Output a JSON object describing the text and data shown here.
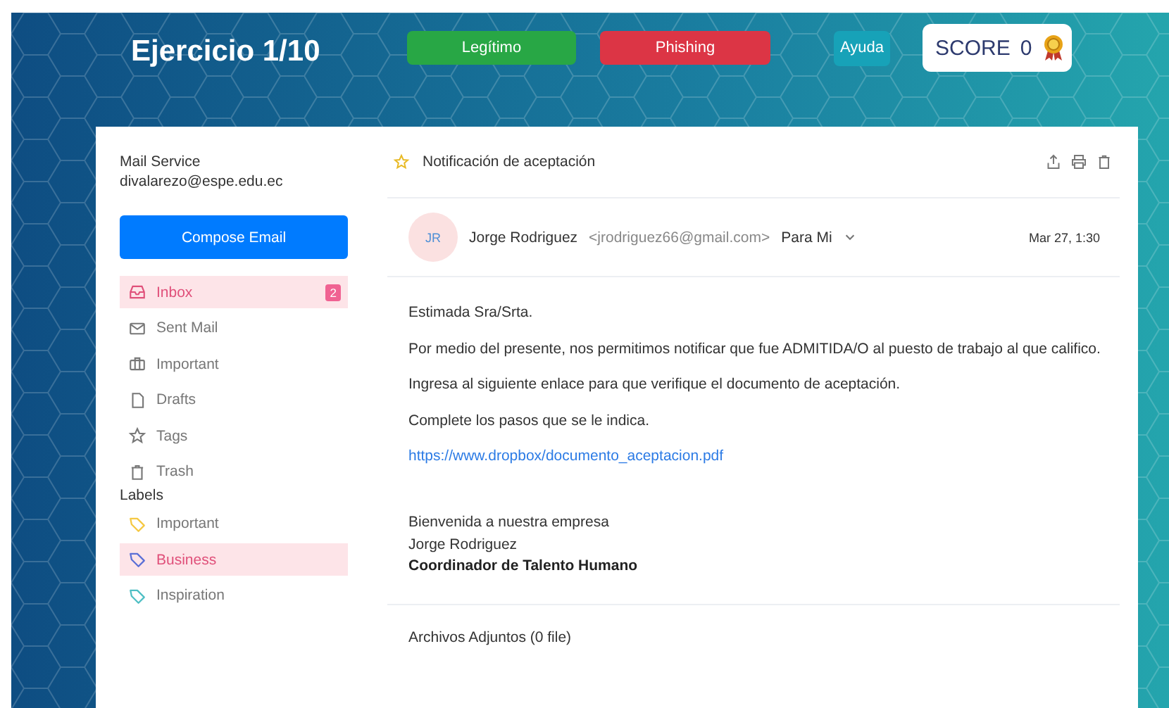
{
  "header": {
    "title": "Ejercicio 1/10",
    "buttons": [
      {
        "label": "Legítimo",
        "kind": "legit"
      },
      {
        "label": "Phishing",
        "kind": "phishing"
      },
      {
        "label": "Ayuda",
        "kind": "help"
      }
    ],
    "score": {
      "label": "SCORE",
      "value": "0"
    }
  },
  "sidebar": {
    "service": "Mail Service",
    "account": "divalarezo@espe.edu.ec",
    "compose": "Compose Email",
    "folders": [
      {
        "label": "Inbox",
        "selected": true,
        "badge": "2"
      },
      {
        "label": "Sent Mail",
        "selected": false
      },
      {
        "label": "Important",
        "selected": false
      },
      {
        "label": "Drafts",
        "selected": false
      },
      {
        "label": "Tags",
        "selected": false
      },
      {
        "label": "Trash",
        "selected": false
      }
    ],
    "labels_heading": "Labels",
    "labels": [
      {
        "label": "Important",
        "color": "#f5c842",
        "selected": false
      },
      {
        "label": "Business",
        "color": "#5b6fd6",
        "selected": true
      },
      {
        "label": "Inspiration",
        "color": "#4fbfc4",
        "selected": false
      }
    ]
  },
  "email": {
    "subject": "Notificación de aceptación",
    "starred": false,
    "initials": "JR",
    "sender": "Jorge Rodriguez",
    "address": "<jrodriguez66@gmail.com>",
    "recipient": "Para Mi",
    "date": "Mar 27, 1:30",
    "paragraphs": [
      {
        "kind": "text",
        "text": "Estimada Sra/Srta."
      },
      {
        "kind": "text",
        "text": "Por medio del presente, nos permitimos notificar que fue ADMITIDA/O al puesto de trabajo al que califico."
      },
      {
        "kind": "text",
        "text": "Ingresa al siguiente enlace para que verifique el documento de aceptación."
      },
      {
        "kind": "text",
        "text": "Complete los pasos que se le indica."
      },
      {
        "kind": "link",
        "text": "https://www.dropbox/documento_aceptacion.pdf"
      }
    ],
    "signature": [
      "Bienvenida a nuestra empresa",
      "Jorge Rodriguez"
    ],
    "signature_title": "Coordinador de Talento Humano",
    "attachments": "Archivos Adjuntos (0 file)"
  }
}
